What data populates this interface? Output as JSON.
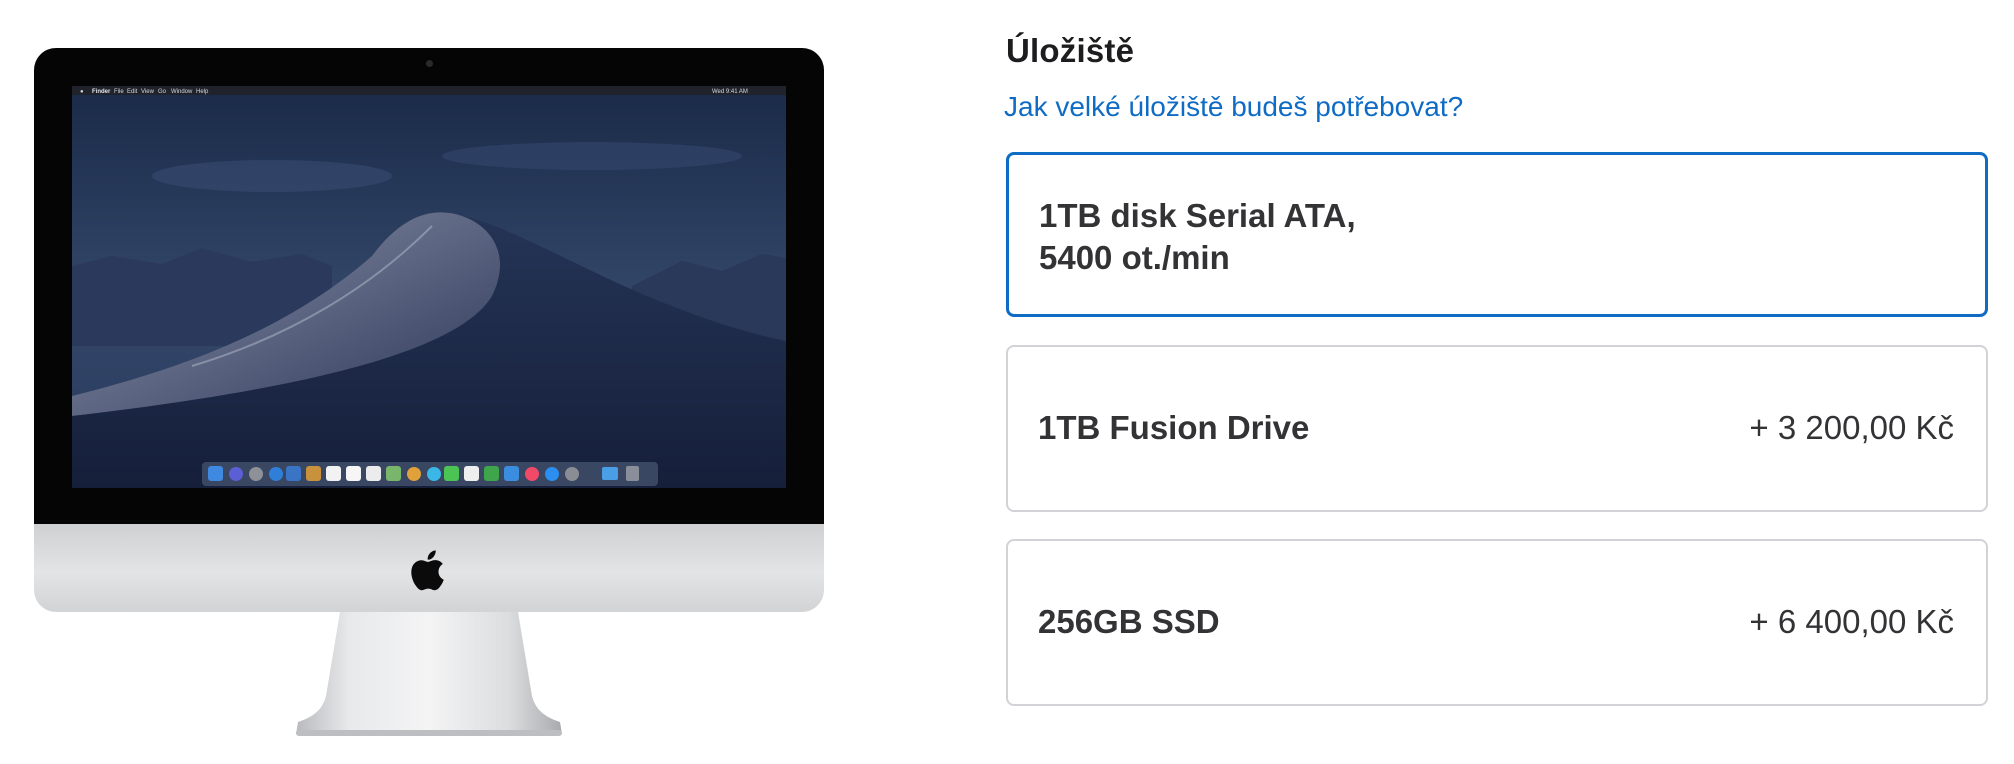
{
  "product_image": {
    "alt": "iMac",
    "menu_bar": {
      "app": "Finder",
      "items": [
        "File",
        "Edit",
        "View",
        "Go",
        "Window",
        "Help"
      ],
      "clock": "Wed 9:41 AM"
    }
  },
  "storage": {
    "title": "Úložiště",
    "help_link": "Jak velké úložiště budeš potřebovat?",
    "options": [
      {
        "label_line1": "1TB disk Serial ATA,",
        "label_line2": "5400 ot./min",
        "price": "",
        "selected": true
      },
      {
        "label": "1TB Fusion Drive",
        "price": "+ 3 200,00 Kč",
        "selected": false
      },
      {
        "label": "256GB SSD",
        "price": "+ 6 400,00 Kč",
        "selected": false
      }
    ]
  },
  "colors": {
    "accent": "#0f6cc4",
    "border": "#d2d2d7",
    "text": "#1d1d1f"
  }
}
